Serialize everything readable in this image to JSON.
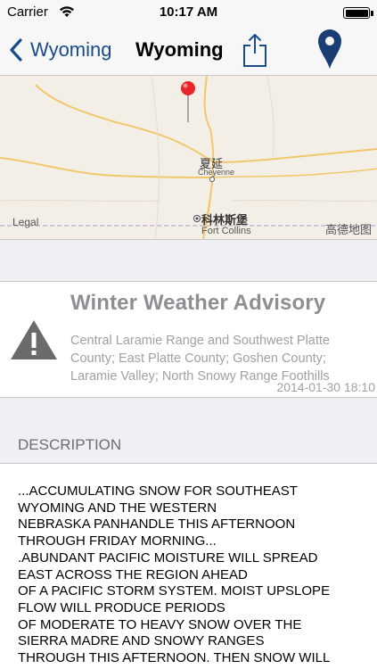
{
  "status_bar": {
    "carrier": "Carrier",
    "time": "10:17 AM",
    "battery_level": 1.0
  },
  "nav": {
    "back_label": "Wyoming",
    "title": "Wyoming",
    "share_icon": "share-icon",
    "pin_icon": "map-pin-icon",
    "accent_color": "#1a4b8c"
  },
  "map": {
    "labels": {
      "cheyenne_cn": "夏延",
      "cheyenne_en": "Cheyenne",
      "fort_collins_cn": "科林斯堡",
      "fort_collins_en": "Fort Collins"
    },
    "legal": "Legal",
    "provider": "高德地图",
    "pin_color": "#e8252b"
  },
  "advisory": {
    "icon": "warning-triangle-icon",
    "title": "Winter Weather Advisory",
    "areas": "Central Laramie Range and Southwest Platte County; East Platte County; Goshen County; Laramie Valley; North Snowy Range Foothills",
    "timestamp": "2014-01-30 18:10"
  },
  "description": {
    "header": "DESCRIPTION",
    "text": "...ACCUMULATING SNOW FOR SOUTHEAST\nWYOMING AND THE WESTERN\nNEBRASKA PANHANDLE THIS AFTERNOON\nTHROUGH FRIDAY MORNING...\n.ABUNDANT PACIFIC MOISTURE WILL SPREAD\nEAST ACROSS THE REGION AHEAD\nOF A PACIFIC STORM SYSTEM. MOIST UPSLOPE\nFLOW WILL PRODUCE PERIODS\nOF MODERATE TO HEAVY SNOW OVER THE\nSIERRA MADRE AND SNOWY RANGES\nTHROUGH THIS AFTERNOON. THEN SNOW WILL"
  }
}
